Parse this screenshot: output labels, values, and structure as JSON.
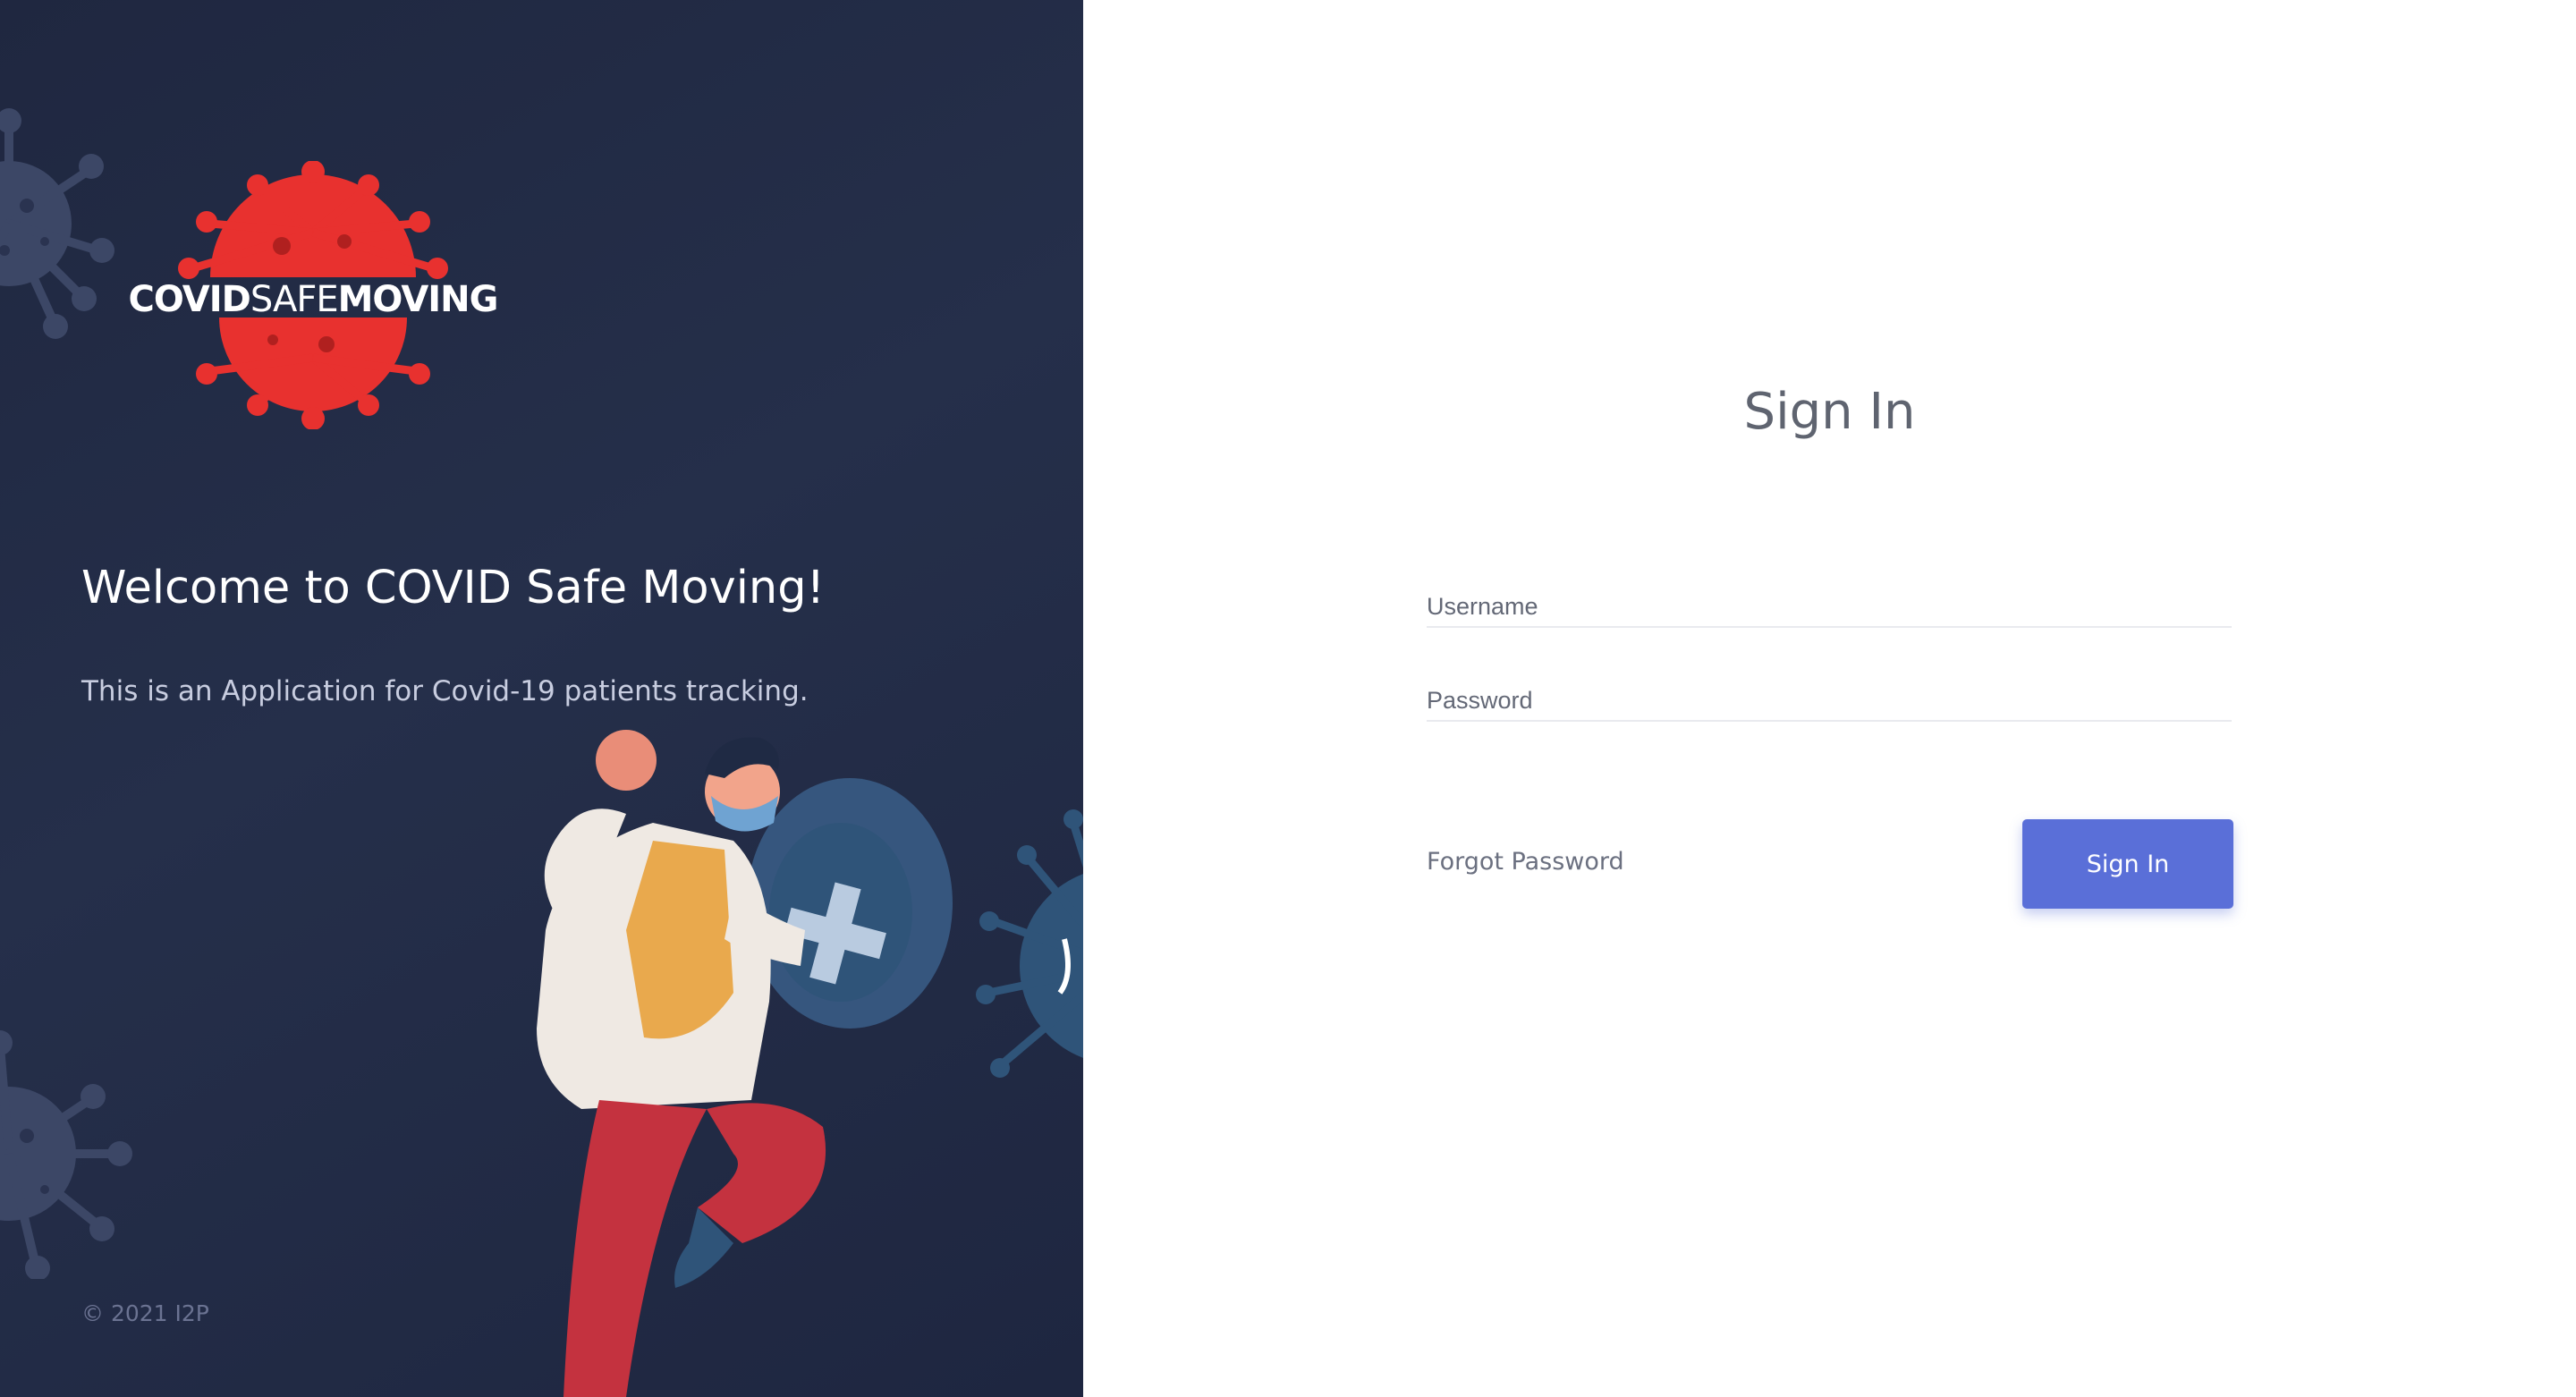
{
  "brand": {
    "logo_bold_1": "COVID",
    "logo_light": "SAFE",
    "logo_bold_2": "MOVING",
    "logo_color": "#e8312f"
  },
  "left_panel": {
    "welcome_title": "Welcome to COVID Safe Moving!",
    "welcome_subtitle": "This is an Application for Covid-19 patients tracking.",
    "copyright": "© 2021 I2P",
    "background_color": "#222b44"
  },
  "form": {
    "title": "Sign In",
    "username_placeholder": "Username",
    "username_value": "",
    "password_placeholder": "Password",
    "password_value": "",
    "forgot_password_label": "Forgot Password",
    "submit_label": "Sign In",
    "accent_color": "#5a6fd8"
  },
  "icons": {
    "logo": "virus-logo-icon",
    "decor": "virus-decor-icon",
    "hero": "doctor-with-shield-illustration"
  }
}
